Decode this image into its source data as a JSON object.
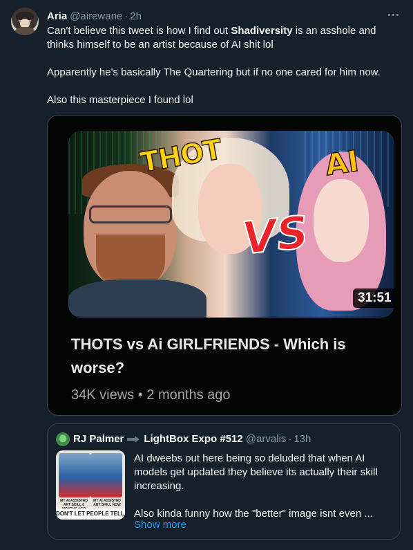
{
  "tweet": {
    "author_name": "Aria",
    "author_handle": "@airewane",
    "separator": "·",
    "time": "2h",
    "body": {
      "line1_pre": "Can't believe this tweet is how I find out ",
      "line1_bold": "Shadiversity",
      "line1_post": " is an asshole and thinks himself to be an artist because of AI shit lol",
      "line2": "Apparently he's basically The Quartering but if no one cared for him now.",
      "line3": "Also this masterpiece I found lol"
    }
  },
  "media": {
    "thumbnail_text_left": "THOT",
    "thumbnail_text_center": "VS",
    "thumbnail_text_right": "AI",
    "duration": "31:51",
    "video_title": "THOTS vs Ai GIRLFRIENDS - Which is worse?",
    "views": "34K views",
    "meta_separator": "•",
    "uploaded": "2 months ago"
  },
  "quoted_tweet": {
    "author_name": "RJ Palmer",
    "event_name": "LightBox Expo #512",
    "author_handle": "@arvalis",
    "separator": "·",
    "time": "13h",
    "thumb_caption_left": "MY AI ASSISTED ART SKILL 6 MONTHS AGO",
    "thumb_caption_right": "MY AI ASSISTED ART SKILL NOW",
    "thumb_bottom": "DON'T LET PEOPLE TELL YOU",
    "text_para1": "AI dweebs out here being so deluded that when AI models get updated they believe its actually their skill increasing.",
    "text_para2": "Also kinda funny how the \"better\" image isnt even ...",
    "show_more": "Show more"
  },
  "colors": {
    "background": "#15202b",
    "text_primary": "#f7f9f9",
    "text_secondary": "#8b98a5",
    "link": "#1d9bf0",
    "border": "#38444d"
  },
  "icons": {
    "more": "more-horizontal-icon",
    "event_arrow": "arrow-right-icon"
  }
}
